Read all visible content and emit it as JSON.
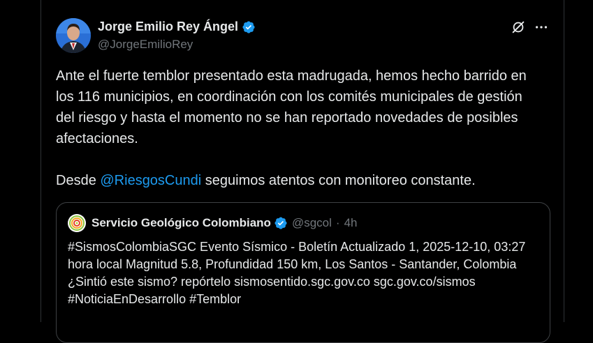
{
  "colors": {
    "accent": "#1d9bf0",
    "text": "#e7e9ea",
    "muted": "#71767b",
    "background": "#000000"
  },
  "author": {
    "display_name": "Jorge Emilio Rey Ángel",
    "handle": "@JorgeEmilioRey",
    "verified": true,
    "avatar": "avatar"
  },
  "header_icons": [
    "grok-icon",
    "more-icon"
  ],
  "tweet": {
    "paragraph1": "Ante el fuerte temblor presentado esta madrugada, hemos hecho barrido en los 116 municipios, en coordinación con los comités municipales de gestión del riesgo y hasta el momento no se han reportado novedades de posibles afectaciones.",
    "paragraph2_before": "Desde ",
    "mention": "@RiesgosCundi",
    "paragraph2_after": " seguimos atentos con monitoreo constante."
  },
  "quoted": {
    "display_name": "Servicio Geológico Colombiano",
    "handle": "@sgcol",
    "separator": "·",
    "time": "4h",
    "verified": true,
    "logo": "sgc-logo",
    "text": "#SismosColombiaSGC Evento Sísmico - Boletín Actualizado 1, 2025-12-10, 03:27 hora local Magnitud 5.8, Profundidad 150 km, Los Santos - Santander, Colombia ¿Sintió este sismo? repórtelo sismosentido.sgc.gov.co sgc.gov.co/sismos #NoticiaEnDesarrollo #Temblor"
  }
}
